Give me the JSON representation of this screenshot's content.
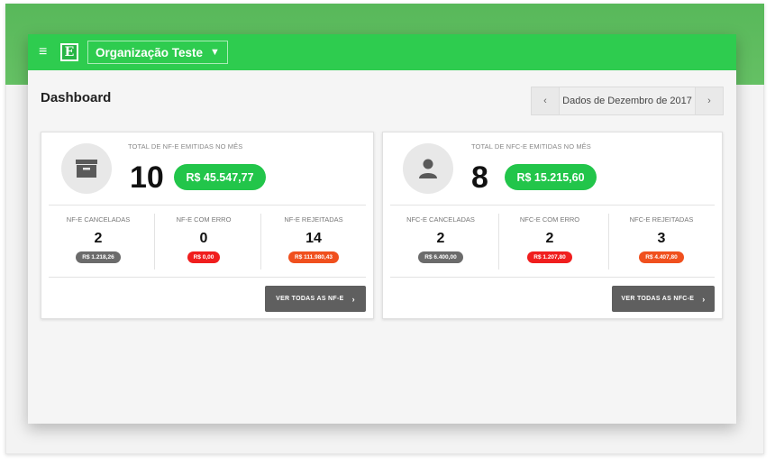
{
  "header": {
    "org_name": "Organização Teste",
    "menu_icon": "hamburger-icon",
    "logo_letter": "E",
    "colors": {
      "bar": "#2ecc4f",
      "accent_green": "#22c54a",
      "gray": "#6b6b6b",
      "red": "#f01e1e",
      "orange": "#f0501e"
    }
  },
  "page": {
    "title": "Dashboard",
    "date_nav": {
      "prev": "‹",
      "label": "Dados de Dezembro de 2017",
      "next": "›"
    }
  },
  "cards": [
    {
      "icon": "archive-box-icon",
      "summary_label": "TOTAL DE NF-E EMITIDAS NO MÊS",
      "count": "10",
      "amount": "R$ 45.547,77",
      "stats": [
        {
          "label": "NF-E CANCELADAS",
          "count": "2",
          "amount": "R$ 1.218,26"
        },
        {
          "label": "NF-E COM ERRO",
          "count": "0",
          "amount": "R$ 0,00"
        },
        {
          "label": "NF-E REJEITADAS",
          "count": "14",
          "amount": "R$ 111.980,43"
        }
      ],
      "button": "VER TODAS AS NF-E",
      "button_chevron": "›"
    },
    {
      "icon": "user-icon",
      "summary_label": "TOTAL DE NFC-E EMITIDAS NO MÊS",
      "count": "8",
      "amount": "R$ 15.215,60",
      "stats": [
        {
          "label": "NFC-E CANCELADAS",
          "count": "2",
          "amount": "R$ 6.400,00"
        },
        {
          "label": "NFC-E COM ERRO",
          "count": "2",
          "amount": "R$ 1.207,80"
        },
        {
          "label": "NFC-E REJEITADAS",
          "count": "3",
          "amount": "R$ 4.407,80"
        }
      ],
      "button": "VER TODAS AS NFC-E",
      "button_chevron": "›"
    }
  ]
}
